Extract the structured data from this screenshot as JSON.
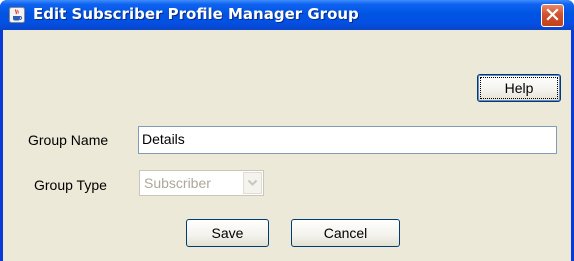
{
  "window": {
    "title": "Edit Subscriber Profile Manager Group",
    "icon": "java-cup-icon",
    "close_icon": "close-x-icon"
  },
  "toolbar": {
    "help_label": "Help"
  },
  "form": {
    "group_name": {
      "label": "Group Name",
      "value": "Details"
    },
    "group_type": {
      "label": "Group Type",
      "selected": "Subscriber",
      "enabled": false
    }
  },
  "actions": {
    "save_label": "Save",
    "cancel_label": "Cancel"
  },
  "colors": {
    "titlebar": "#0054e3",
    "client_bg": "#ece9d8",
    "close_button": "#d2512c",
    "button_border": "#003c74"
  }
}
